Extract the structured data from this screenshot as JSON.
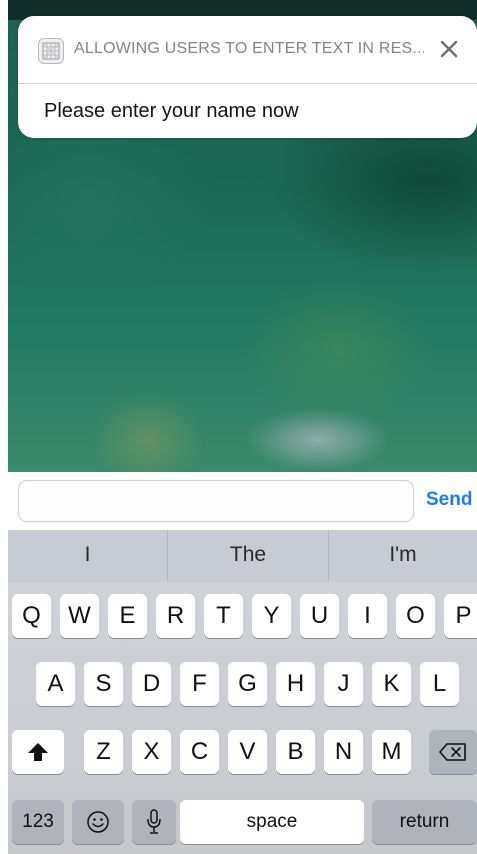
{
  "notification": {
    "app_name": "ALLOWING USERS TO ENTER TEXT IN RES...",
    "message": "Please enter your name now",
    "icon": "app-grid-icon",
    "close_icon": "close-icon"
  },
  "reply": {
    "input_value": "",
    "send_label": "Send",
    "accent_color": "#1a7cf2"
  },
  "keyboard": {
    "suggestions": [
      "I",
      "The",
      "I'm"
    ],
    "row1": [
      "Q",
      "W",
      "E",
      "R",
      "T",
      "Y",
      "U",
      "I",
      "O",
      "P"
    ],
    "row2": [
      "A",
      "S",
      "D",
      "F",
      "G",
      "H",
      "J",
      "K",
      "L"
    ],
    "row3": [
      "Z",
      "X",
      "C",
      "V",
      "B",
      "N",
      "M"
    ],
    "shift_icon": "shift-icon",
    "backspace_icon": "backspace-icon",
    "numbers_label": "123",
    "emoji_icon": "emoji-icon",
    "mic_icon": "microphone-icon",
    "space_label": "space",
    "return_label": "return"
  }
}
